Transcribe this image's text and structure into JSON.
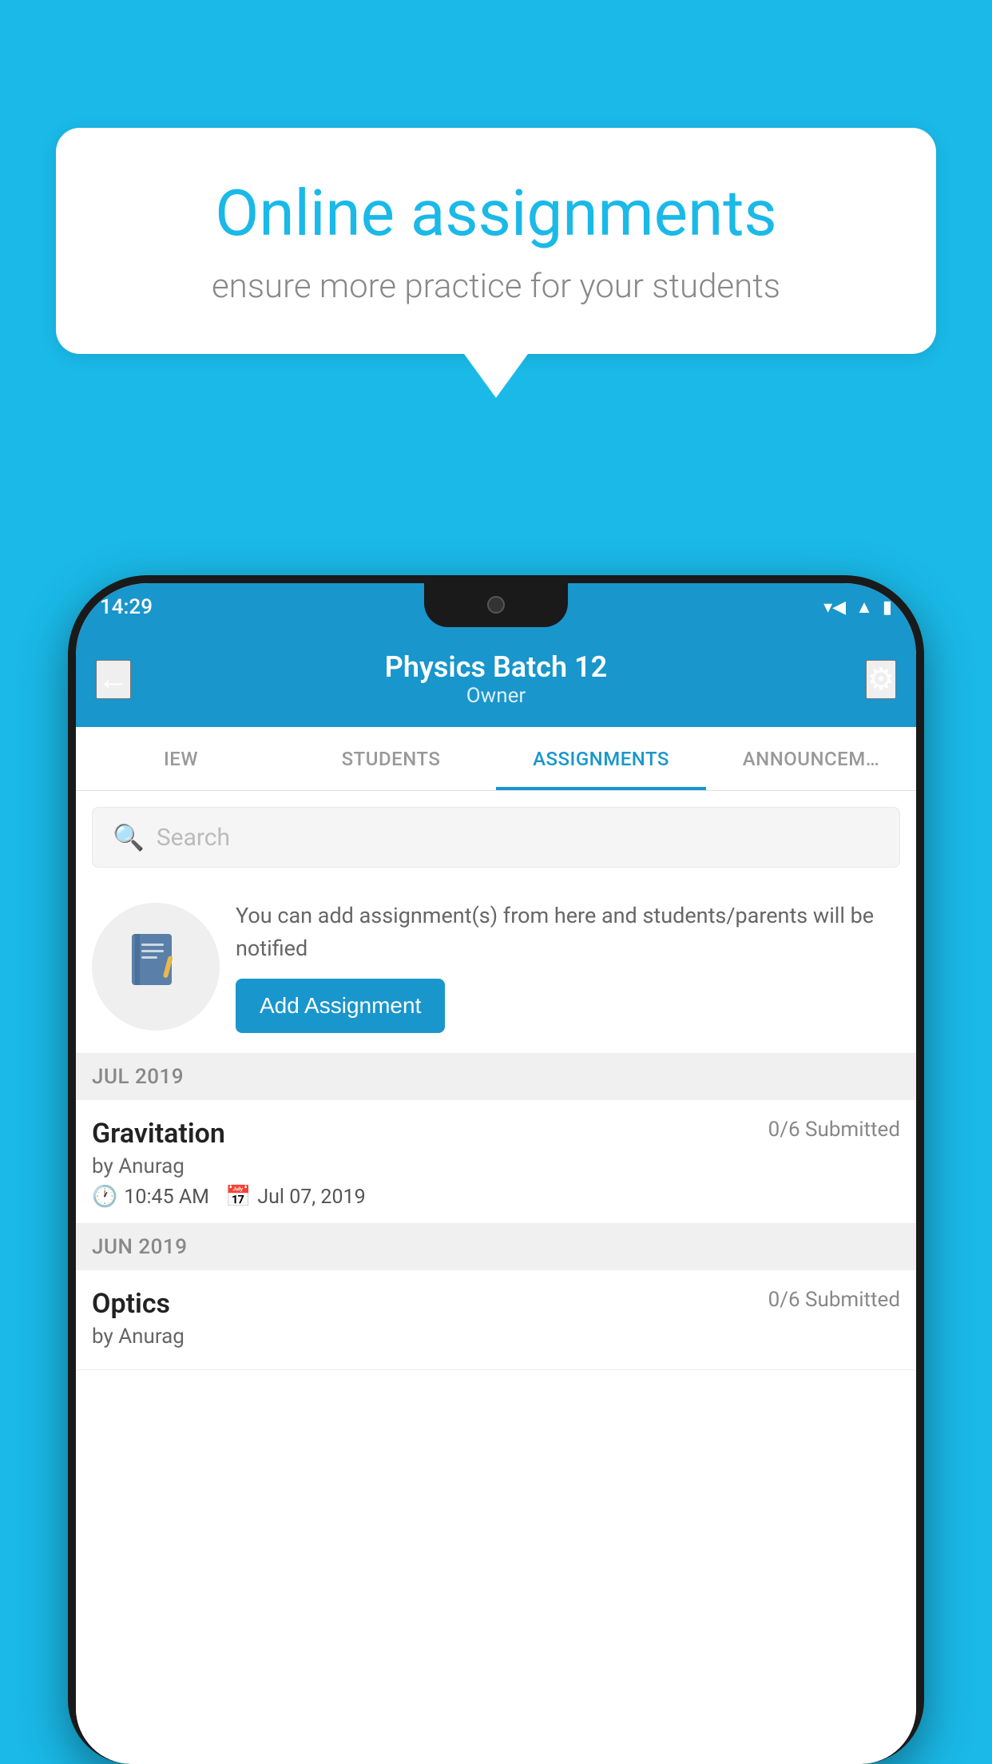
{
  "background": {
    "color": "#1ab9e8"
  },
  "speech_bubble": {
    "title": "Online assignments",
    "subtitle": "ensure more practice for your students"
  },
  "status_bar": {
    "time": "14:29",
    "wifi": "▼",
    "signal": "▲",
    "battery": "▮"
  },
  "header": {
    "title": "Physics Batch 12",
    "subtitle": "Owner",
    "back_label": "←",
    "settings_label": "⚙"
  },
  "tabs": [
    {
      "label": "IEW",
      "active": false
    },
    {
      "label": "STUDENTS",
      "active": false
    },
    {
      "label": "ASSIGNMENTS",
      "active": true
    },
    {
      "label": "ANNOUNCEM…",
      "active": false
    }
  ],
  "search": {
    "placeholder": "Search"
  },
  "promo": {
    "text": "You can add assignment(s) from here and students/parents will be notified",
    "button_label": "Add Assignment"
  },
  "sections": [
    {
      "label": "JUL 2019",
      "assignments": [
        {
          "name": "Gravitation",
          "submitted": "0/6 Submitted",
          "author": "by Anurag",
          "time": "10:45 AM",
          "date": "Jul 07, 2019"
        }
      ]
    },
    {
      "label": "JUN 2019",
      "assignments": [
        {
          "name": "Optics",
          "submitted": "0/6 Submitted",
          "author": "by Anurag",
          "time": "",
          "date": ""
        }
      ]
    }
  ]
}
